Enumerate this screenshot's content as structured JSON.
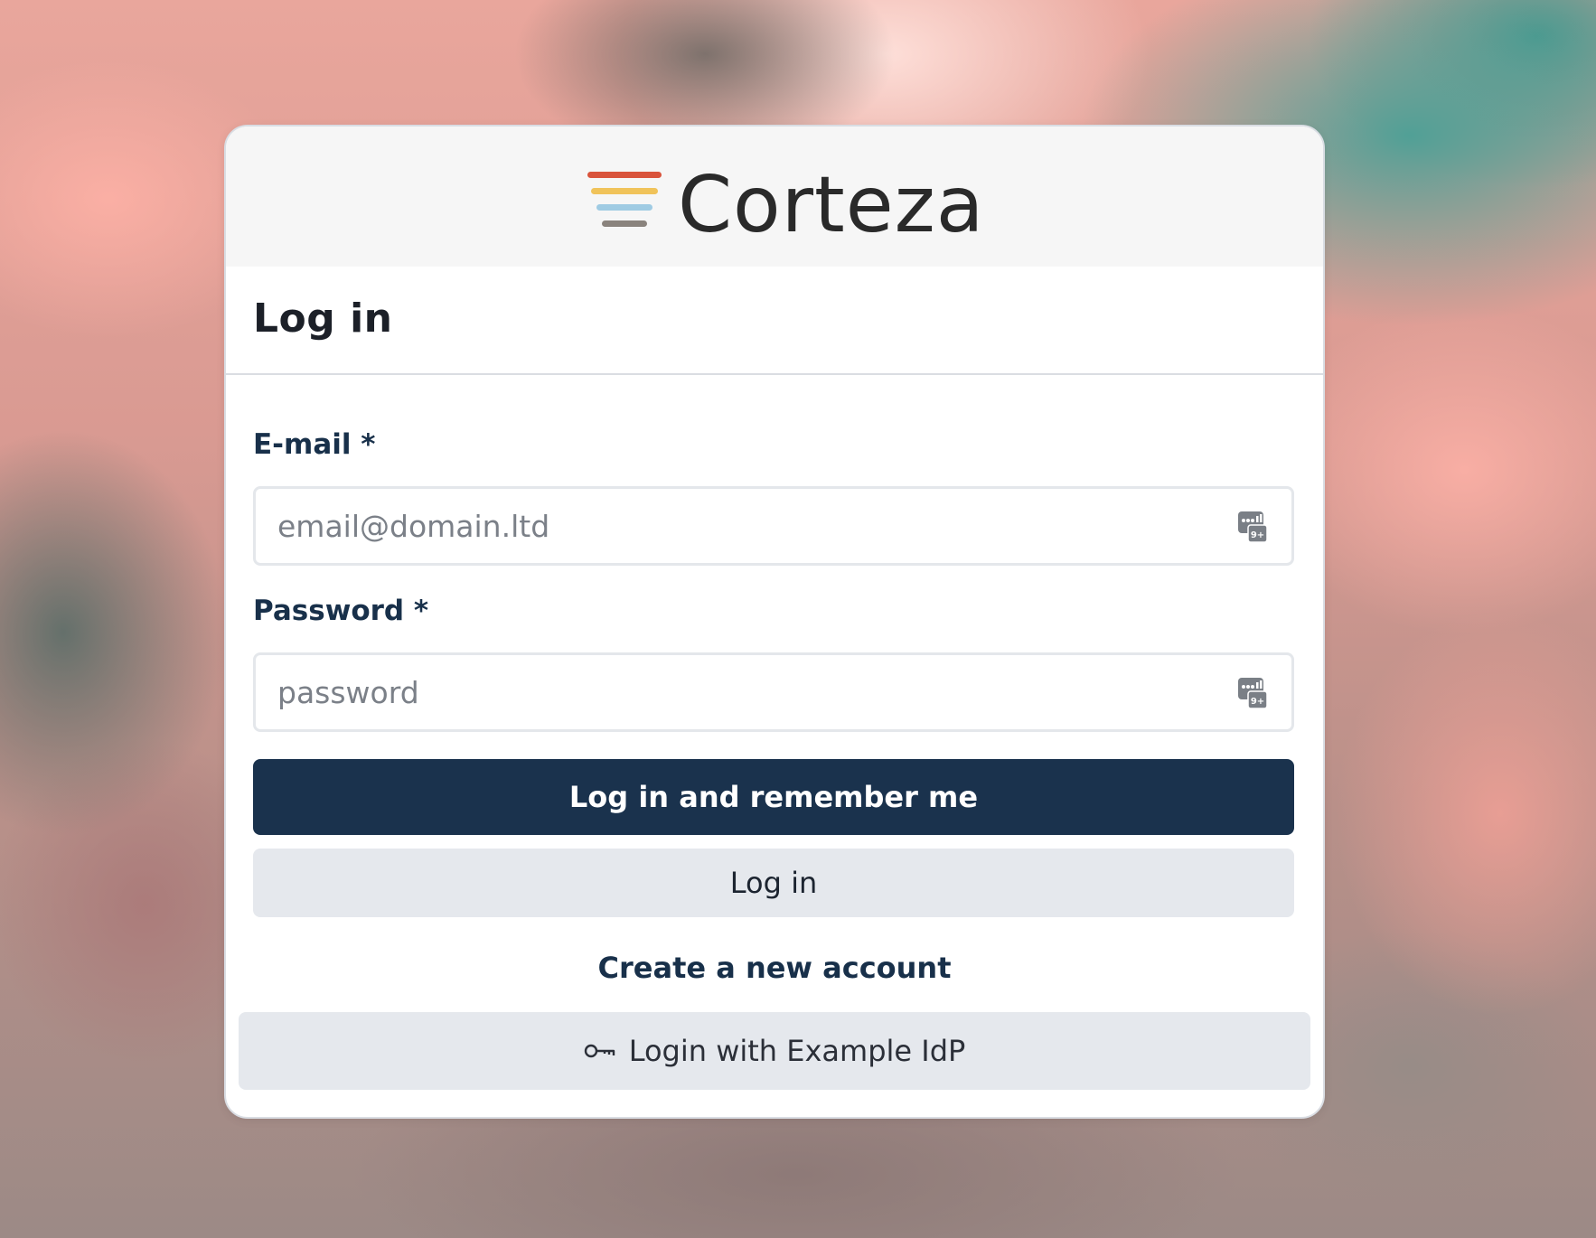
{
  "app": {
    "brand_name": "Corteza",
    "logo_colors": [
      "#d9533b",
      "#f0c35a",
      "#9fcbe3",
      "#8a837d"
    ]
  },
  "login_card": {
    "title": "Log in",
    "email_field": {
      "label": "E-mail *",
      "placeholder": "email@domain.ltd",
      "value": "",
      "icon": "password-manager-icon"
    },
    "password_field": {
      "label": "Password *",
      "placeholder": "password",
      "value": "",
      "icon": "password-manager-icon"
    },
    "remember_button_label": "Log in and remember me",
    "login_button_label": "Log in",
    "create_account_link": "Create a new account",
    "idp_button": {
      "label": "Login with Example IdP",
      "icon": "key-icon"
    }
  },
  "colors": {
    "primary": "#1a324d",
    "secondary_button": "#e5e8ed",
    "label_text": "#18304a"
  }
}
